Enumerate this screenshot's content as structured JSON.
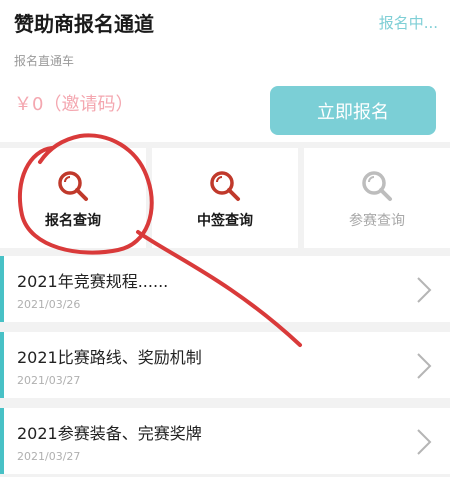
{
  "header": {
    "title": "赞助商报名通道",
    "status": "报名中...",
    "subtitle": "报名直通车",
    "price": "￥0（邀请码）",
    "register_button": "立即报名"
  },
  "menu": [
    {
      "label": "报名查询",
      "icon": "search-icon",
      "enabled": true
    },
    {
      "label": "中签查询",
      "icon": "search-icon",
      "enabled": true
    },
    {
      "label": "参赛查询",
      "icon": "search-icon",
      "enabled": false
    }
  ],
  "list": [
    {
      "title": "2021年竞赛规程......",
      "date": "2021/03/26"
    },
    {
      "title": "2021比赛路线、奖励机制",
      "date": "2021/03/27"
    },
    {
      "title": "2021参赛装备、完赛奖牌",
      "date": "2021/03/27"
    }
  ],
  "colors": {
    "accent": "#48c1c6",
    "button": "#7bcfd6",
    "icon_active": "#c0392b",
    "icon_disabled": "#bdbdbd",
    "annotation": "#d93a3a"
  }
}
